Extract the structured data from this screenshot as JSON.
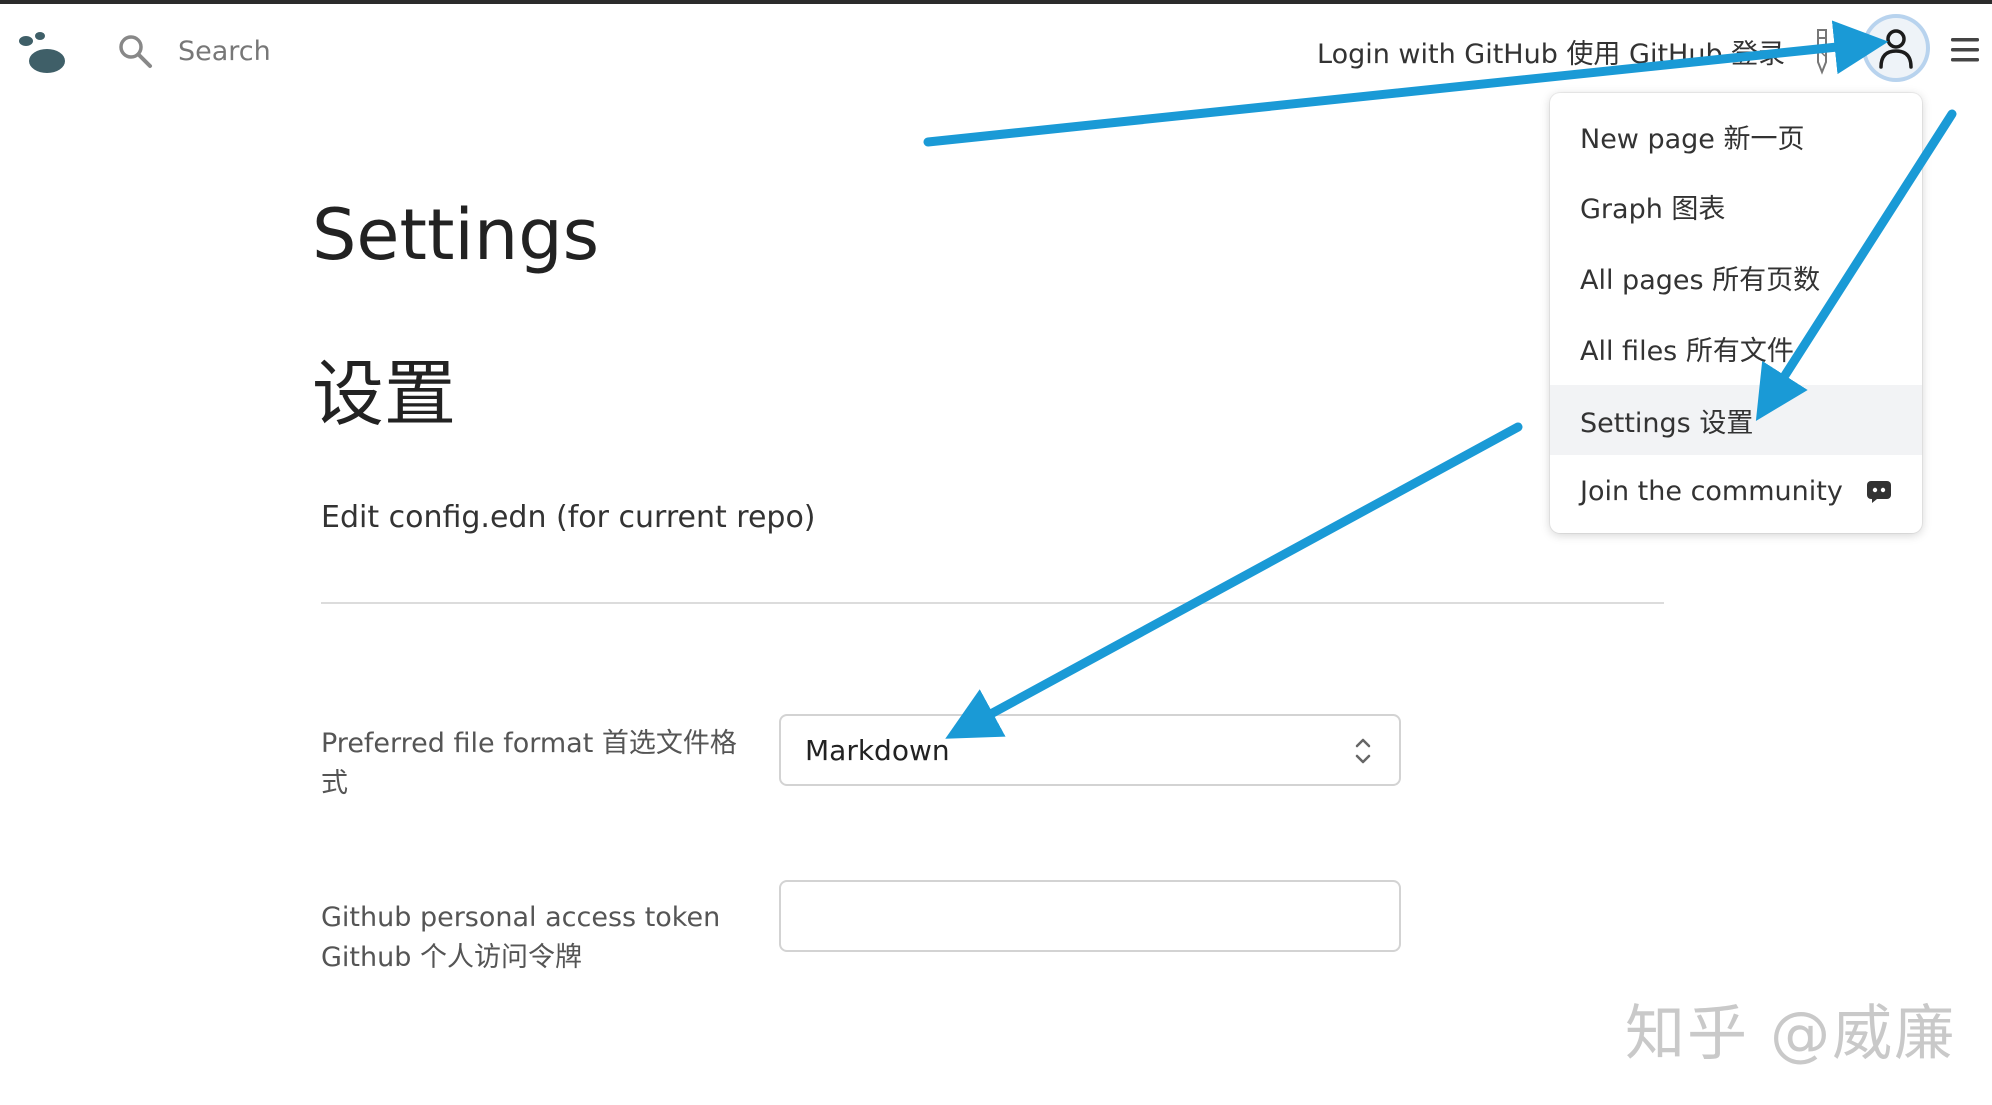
{
  "header": {
    "search_placeholder": "Search",
    "login_label": "Login with GitHub 使用 GitHub 登录"
  },
  "menu": {
    "items": [
      {
        "label": "New page 新一页"
      },
      {
        "label": "Graph 图表"
      },
      {
        "label": "All pages 所有页数"
      },
      {
        "label": "All files 所有文件"
      },
      {
        "label": "Settings 设置"
      },
      {
        "label": "Join the community"
      }
    ],
    "active_index": 4
  },
  "main": {
    "title": "Settings",
    "title_cn": "设置",
    "edit_config": "Edit config.edn (for current repo)",
    "file_format": {
      "label": "Preferred file format 首选文件格式",
      "value": "Markdown"
    },
    "github_token": {
      "label": "Github personal access token Github 个人访问令牌",
      "value": ""
    }
  },
  "watermark": "知乎 @威廉",
  "colors": {
    "arrow": "#1a9ad6",
    "menu_active_bg": "#f2f3f5",
    "avatar_ring": "#b8d3ee",
    "logo": "#3f5f68"
  }
}
